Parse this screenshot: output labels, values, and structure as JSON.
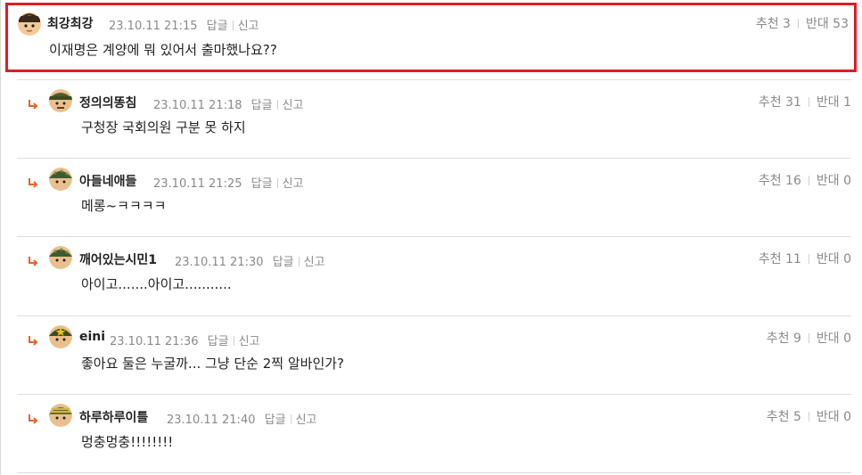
{
  "comments": [
    {
      "nick": "최강최강",
      "date": "23.10.11 21:15",
      "reply": "답글",
      "report": "신고",
      "text": "이재명은 계양에 뭐 있어서 출마했나요??",
      "up_label": "추천",
      "up": "3",
      "down_label": "반대",
      "down": "53",
      "avatar_color": "#6b4a2b"
    },
    {
      "nick": "정의의똥침",
      "date": "23.10.11 21:18",
      "reply": "답글",
      "report": "신고",
      "text": "구청장 국회의원 구분 못 하지",
      "up_label": "추천",
      "up": "31",
      "down_label": "반대",
      "down": "1",
      "avatar_color": "#4d5c2a"
    },
    {
      "nick": "아들네애들",
      "date": "23.10.11 21:25",
      "reply": "답글",
      "report": "신고",
      "text": "메롱~ㅋㅋㅋㅋ",
      "up_label": "추천",
      "up": "16",
      "down_label": "반대",
      "down": "0",
      "avatar_color": "#3f5a2e"
    },
    {
      "nick": "깨어있는시민1",
      "date": "23.10.11 21:30",
      "reply": "답글",
      "report": "신고",
      "text": "아이고.......아이고...........",
      "up_label": "추천",
      "up": "11",
      "down_label": "반대",
      "down": "0",
      "avatar_color": "#3f5a2e"
    },
    {
      "nick": "eini",
      "date": "23.10.11 21:36",
      "reply": "답글",
      "report": "신고",
      "text": "좋아요 둘은 누굴까... 그냥 단순 2찍 알바인가?",
      "up_label": "추천",
      "up": "9",
      "down_label": "반대",
      "down": "0",
      "avatar_color": "#3b4b24"
    },
    {
      "nick": "하루하루이틀",
      "date": "23.10.11 21:40",
      "reply": "답글",
      "report": "신고",
      "text": "멍충멍충!!!!!!!!",
      "up_label": "추천",
      "up": "5",
      "down_label": "반대",
      "down": "0",
      "avatar_color": "#6e6b2a"
    }
  ],
  "icons": {
    "reply_arrow": "reply-arrow-icon"
  },
  "colors": {
    "highlight_border": "#e11b22",
    "reply_arrow": "#e8632a"
  }
}
